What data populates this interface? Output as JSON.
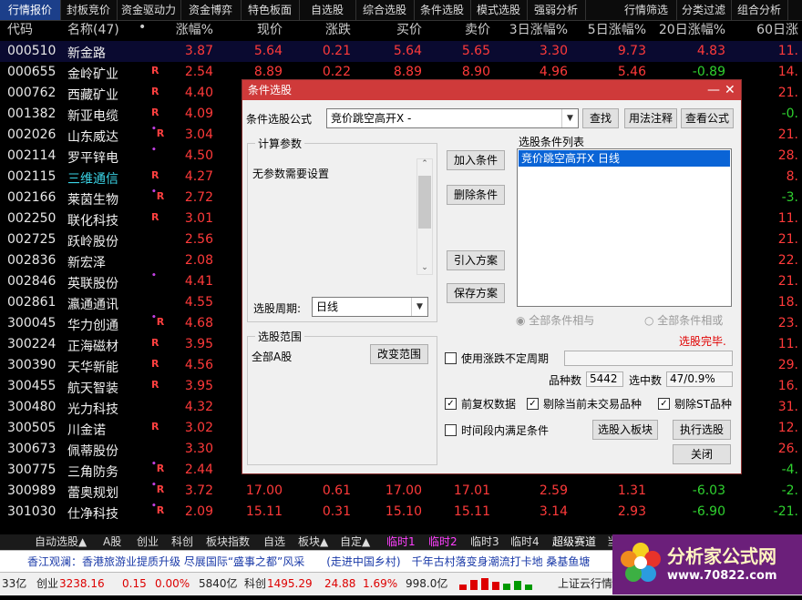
{
  "top_tabs": [
    "行情报价",
    "封板竞价",
    "资金驱动力",
    "资金博弈",
    "特色板面",
    "自选股",
    "综合选股",
    "条件选股",
    "模式选股",
    "强弱分析",
    "行情筛选",
    "分类过滤",
    "组合分析"
  ],
  "columns": {
    "code": "代码",
    "name": "名称(47)",
    "dot": "•",
    "pct": "涨幅%",
    "now": "现价",
    "chg": "涨跌",
    "buy": "买价",
    "sell": "卖价",
    "d3": "3日涨幅%",
    "d5": "5日涨幅%",
    "d20": "20日涨幅%",
    "d60": "60日涨"
  },
  "rows": [
    {
      "code": "000510",
      "name": "新金路",
      "mark": "",
      "pct": "3.87",
      "now": "5.64",
      "chg": "0.21",
      "buy": "5.64",
      "sell": "5.65",
      "d3": "3.30",
      "d5": "9.73",
      "d20": "4.83",
      "d60": "11."
    },
    {
      "code": "000655",
      "name": "金岭矿业",
      "mark": "R",
      "pct": "2.54",
      "now": "8.89",
      "chg": "0.22",
      "buy": "8.89",
      "sell": "8.90",
      "d3": "4.96",
      "d5": "5.46",
      "d20": "-0.89",
      "d60": "14."
    },
    {
      "code": "000762",
      "name": "西藏矿业",
      "mark": "R",
      "pct": "4.40",
      "d60": "21."
    },
    {
      "code": "001382",
      "name": "新亚电缆",
      "mark": "R",
      "pct": "4.09",
      "d60": "-0."
    },
    {
      "code": "002026",
      "name": "山东威达",
      "mark": "•R",
      "pct": "3.04",
      "d60": "21."
    },
    {
      "code": "002114",
      "name": "罗平锌电",
      "mark": "•",
      "pct": "4.50",
      "d60": "28."
    },
    {
      "code": "002115",
      "name": "三维通信",
      "mark": "R",
      "pct": "4.27",
      "d60": "8."
    },
    {
      "code": "002166",
      "name": "莱茵生物",
      "mark": "•R",
      "pct": "2.72",
      "d60": "-3."
    },
    {
      "code": "002250",
      "name": "联化科技",
      "mark": "R",
      "pct": "3.01",
      "d60": "11."
    },
    {
      "code": "002725",
      "name": "跃岭股份",
      "mark": "",
      "pct": "2.56",
      "d60": "21."
    },
    {
      "code": "002836",
      "name": "新宏泽",
      "mark": "",
      "pct": "2.08",
      "d60": "22."
    },
    {
      "code": "002846",
      "name": "英联股份",
      "mark": "•",
      "pct": "4.41",
      "d60": "21."
    },
    {
      "code": "002861",
      "name": "瀛通通讯",
      "mark": "",
      "pct": "4.55",
      "d60": "18."
    },
    {
      "code": "300045",
      "name": "华力创通",
      "mark": "•R",
      "pct": "4.68",
      "d60": "23."
    },
    {
      "code": "300224",
      "name": "正海磁材",
      "mark": "R",
      "pct": "3.95",
      "d60": "11."
    },
    {
      "code": "300390",
      "name": "天华新能",
      "mark": "R",
      "pct": "4.56",
      "d60": "29."
    },
    {
      "code": "300455",
      "name": "航天智装",
      "mark": "R",
      "pct": "3.95",
      "d60": "16."
    },
    {
      "code": "300480",
      "name": "光力科技",
      "mark": "",
      "pct": "4.32",
      "d60": "31."
    },
    {
      "code": "300505",
      "name": "川金诺",
      "mark": "R",
      "pct": "3.02",
      "d60": "12."
    },
    {
      "code": "300673",
      "name": "佩蒂股份",
      "mark": "",
      "pct": "3.30",
      "d60": "26."
    },
    {
      "code": "300775",
      "name": "三角防务",
      "mark": "•R",
      "pct": "2.44",
      "d60": "-4."
    },
    {
      "code": "300989",
      "name": "蕾奥规划",
      "mark": "•R",
      "pct": "3.72",
      "now": "17.00",
      "chg": "0.61",
      "buy": "17.00",
      "sell": "17.01",
      "d3": "2.59",
      "d5": "1.31",
      "d20": "-6.03",
      "d60": "-2."
    },
    {
      "code": "301030",
      "name": "仕净科技",
      "mark": "•R",
      "pct": "2.09",
      "now": "15.11",
      "chg": "0.31",
      "buy": "15.10",
      "sell": "15.11",
      "d3": "3.14",
      "d5": "2.93",
      "d20": "-6.90",
      "d60": "-21."
    }
  ],
  "bottom_tabs": [
    "自动选股▲",
    "A股",
    "创业",
    "科创",
    "板块指数",
    "自选",
    "板块▲",
    "自定▲",
    "临时1",
    "临时2",
    "临时3",
    "临时4",
    "超级赛道",
    "当日预警",
    "叫良竞价",
    "错选股结果"
  ],
  "ticker": "香江观澜：香港旅游业提质升级 尽展国际“盛事之都”风采　　(走进中国乡村)　千年古村落变身潮流打卡地 桑基鱼塘",
  "status": {
    "s1": "33亿",
    "s2_label": "创业",
    "s2_val": "3238.16",
    "s2_chg": "0.15",
    "s2_pct": "0.00%",
    "s2_vol": "5840亿",
    "s3_label": "科创",
    "s3_val": "1495.29",
    "s3_chg": "24.88",
    "s3_pct": "1.69%",
    "s3_vol": "998.0亿",
    "cloud": "上证云行情"
  },
  "logo": {
    "line1": "分析家公式网",
    "line2": "www.70822.com"
  },
  "dialog": {
    "title": "条件选股",
    "formula_label": "条件选股公式",
    "formula_value": "竞价跳空高开X  -",
    "btn_find": "查找",
    "btn_usage": "用法注释",
    "btn_view": "查看公式",
    "params_label": "计算参数",
    "params_text": "无参数需要设置",
    "period_label": "选股周期:",
    "period_value": "日线",
    "btn_add": "加入条件",
    "btn_del": "删除条件",
    "btn_import": "引入方案",
    "btn_save": "保存方案",
    "cond_list_label": "选股条件列表",
    "cond_item": "竞价跳空高开X  日线",
    "radio_and": "全部条件相与",
    "radio_or": "全部条件相或",
    "range_label": "选股范围",
    "range_value": "全部A股",
    "btn_range": "改变范围",
    "done": "选股完毕.",
    "chk_variable": "使用涨跌不定周期",
    "count_label": "品种数",
    "count_value": "5442",
    "selected_label": "选中数",
    "selected_value": "47/0.9%",
    "chk_adjust": "前复权数据",
    "chk_untraded": "剔除当前未交易品种",
    "chk_st": "剔除ST品种",
    "chk_timespan": "时间段内满足条件",
    "btn_to_block": "选股入板块",
    "btn_execute": "执行选股",
    "btn_close": "关闭"
  }
}
